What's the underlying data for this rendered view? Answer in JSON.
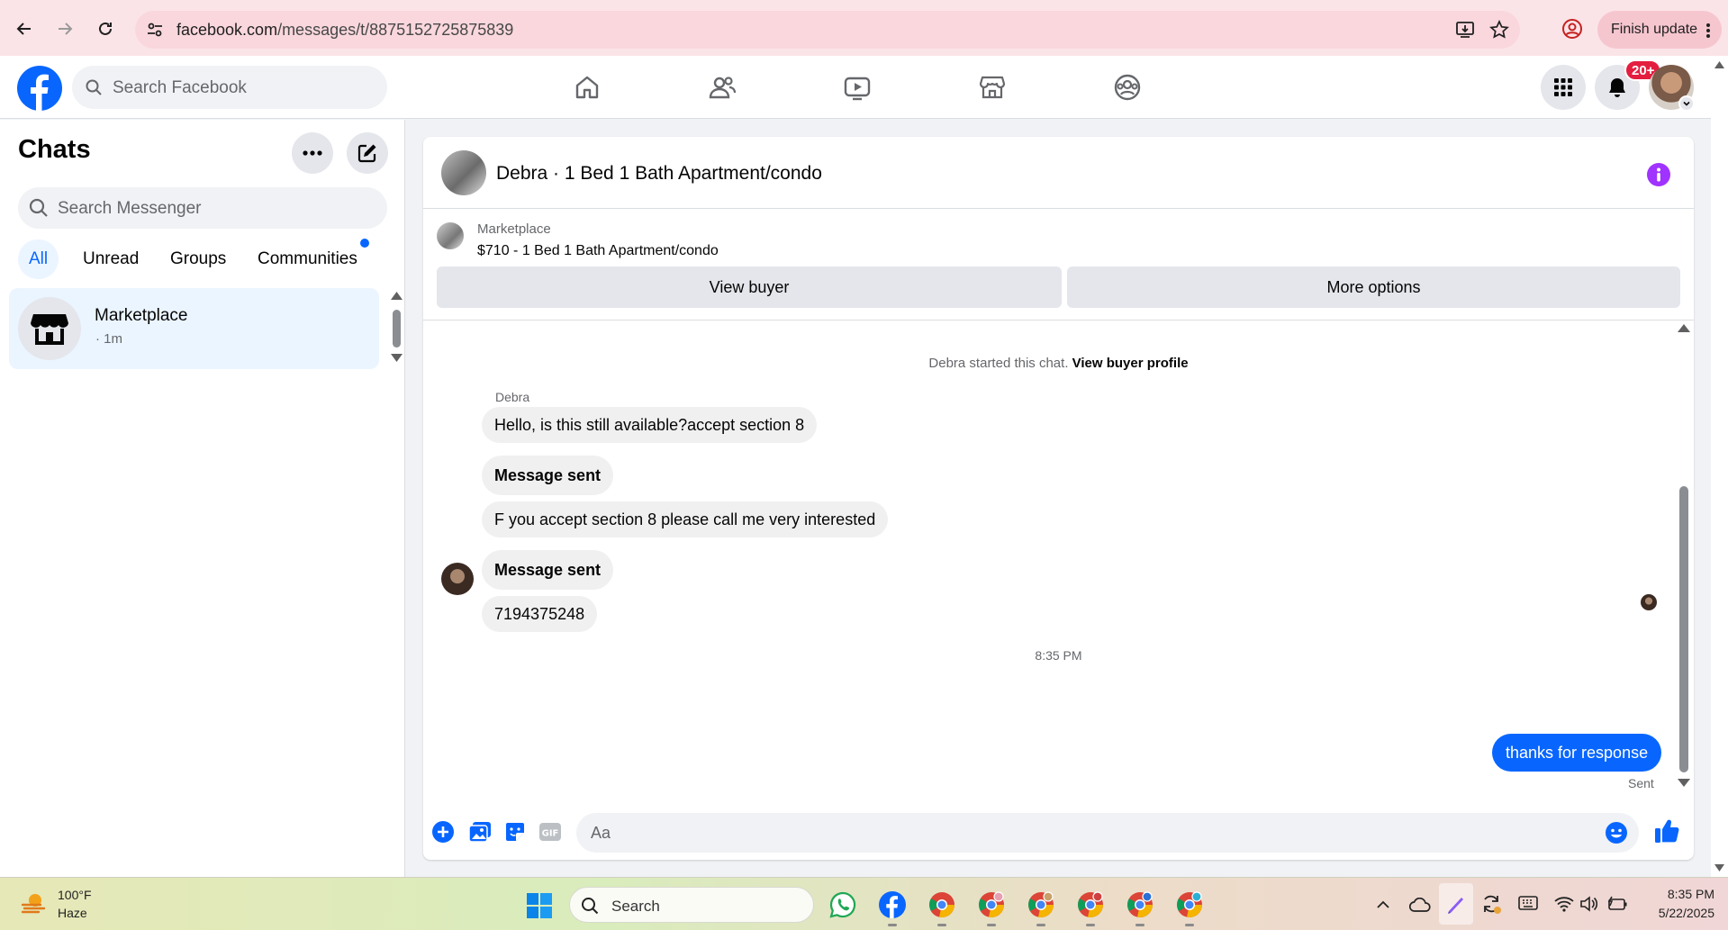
{
  "browser": {
    "url_host": "facebook.com",
    "url_path": "/messages/t/8875152725875839",
    "finish_update_label": "Finish update"
  },
  "header": {
    "search_placeholder": "Search Facebook",
    "notification_badge": "20+"
  },
  "sidebar": {
    "title": "Chats",
    "search_placeholder": "Search Messenger",
    "filters": [
      "All",
      "Unread",
      "Groups",
      "Communities"
    ],
    "active_filter": "All",
    "chats": [
      {
        "name": "Marketplace",
        "time": "· 1m"
      }
    ]
  },
  "chat": {
    "title": "Debra · 1 Bed 1 Bath Apartment/condo",
    "listing_source": "Marketplace",
    "listing_price_title": "$710 - 1 Bed 1 Bath Apartment/condo",
    "view_buyer_label": "View buyer",
    "more_options_label": "More options",
    "system_message": "Debra started this chat.",
    "system_link": "View buyer profile",
    "sender_name": "Debra",
    "messages": [
      {
        "text": "Hello, is this still available?accept section 8",
        "bold": false
      },
      {
        "text": "Message sent",
        "bold": true
      },
      {
        "text": "F you accept section 8 please call me very interested",
        "bold": false
      },
      {
        "text": "Message sent",
        "bold": true
      },
      {
        "text": "7194375248",
        "bold": false
      }
    ],
    "timestamp": "8:35 PM",
    "my_message": "thanks for response",
    "my_message_status": "Sent",
    "composer_placeholder": "Aa"
  },
  "taskbar": {
    "weather_temp": "100°F",
    "weather_condition": "Haze",
    "search_placeholder": "Search",
    "time": "8:35 PM",
    "date": "5/22/2025"
  },
  "colors": {
    "fb_blue": "#0866ff",
    "badge_red": "#e41e3f",
    "info_purple": "#a033ff"
  }
}
